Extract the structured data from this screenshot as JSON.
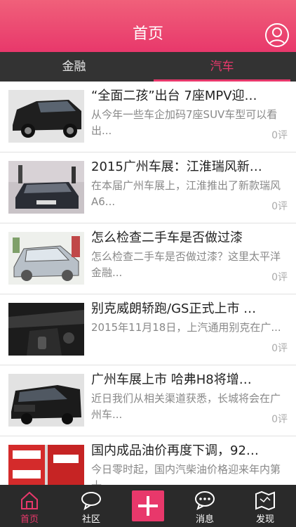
{
  "header": {
    "title": "首页",
    "avatar_icon": "user-avatar-icon"
  },
  "tabs": [
    {
      "label": "金融",
      "active": false
    },
    {
      "label": "汽车",
      "active": true
    }
  ],
  "articles": [
    {
      "title": "“全面二孩”出台 7座MPV迎…",
      "desc": "从今年一些车企加码7座SUV车型可以看出...",
      "count": "0评"
    },
    {
      "title": "2015广州车展：江淮瑞风新…",
      "desc": "在本届广州车展上，江淮推出了新款瑞风A6...",
      "count": "0评"
    },
    {
      "title": "怎么检查二手车是否做过漆",
      "desc": "怎么检查二手车是否做过漆？这里太平洋金融...",
      "count": "0评"
    },
    {
      "title": "别克威朗轿跑/GS正式上市 …",
      "desc": "2015年11月18日，上汽通用别克在广...",
      "count": "0评"
    },
    {
      "title": "广州车展上市 哈弗H8将增…",
      "desc": "近日我们从相关渠道获悉，长城将会在广州车...",
      "count": "0评"
    },
    {
      "title": "国内成品油价再度下调，92…",
      "desc": "今日零时起，国内汽柴油价格迎来年内第十...",
      "count": "0评"
    }
  ],
  "tabbar": {
    "home": "首页",
    "community": "社区",
    "messages": "消息",
    "discover": "发现"
  },
  "colors": {
    "brand": "#e8386b",
    "dark": "#333333"
  }
}
